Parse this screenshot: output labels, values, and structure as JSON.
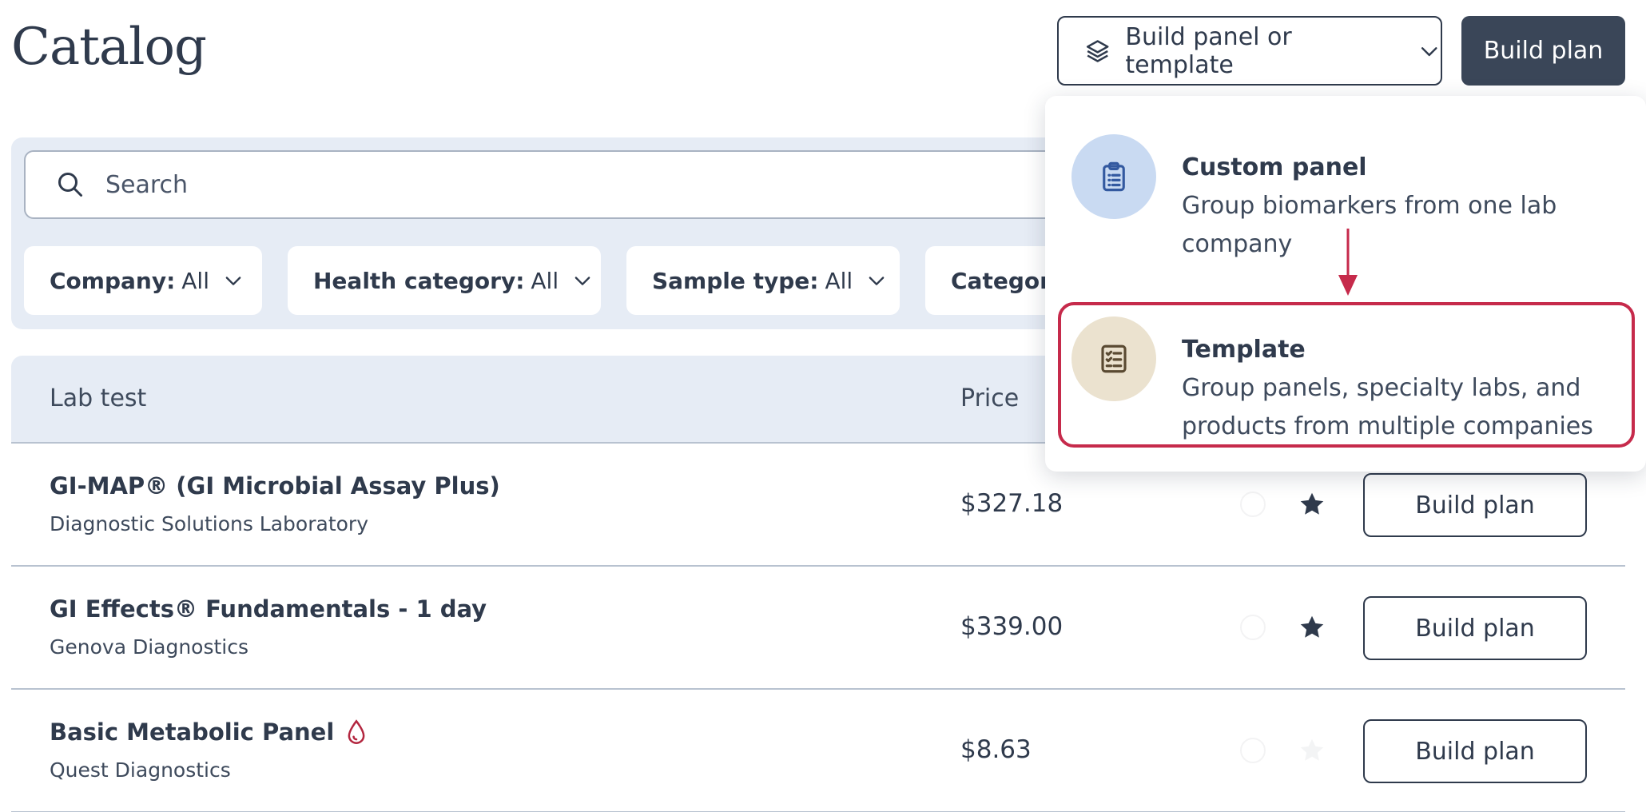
{
  "page": {
    "title": "Catalog"
  },
  "header": {
    "build_dropdown_label": "Build panel or template",
    "build_plan_label": "Build plan"
  },
  "search": {
    "placeholder": "Search"
  },
  "filters": [
    {
      "label": "Company:",
      "value": "All"
    },
    {
      "label": "Health category:",
      "value": "All"
    },
    {
      "label": "Sample type:",
      "value": "All"
    },
    {
      "label": "Category",
      "value": ""
    }
  ],
  "table": {
    "columns": [
      "Lab test",
      "Price"
    ],
    "rows": [
      {
        "name": "GI-MAP® (GI Microbial Assay Plus)",
        "company": "Diagnostic Solutions Laboratory",
        "price": "$327.18",
        "favorited": true,
        "action": "Build plan"
      },
      {
        "name": "GI Effects® Fundamentals - 1 day",
        "company": "Genova Diagnostics",
        "price": "$339.00",
        "favorited": true,
        "action": "Build plan"
      },
      {
        "name": "Basic Metabolic Panel",
        "company": "Quest Diagnostics",
        "price": "$8.63",
        "favorited": false,
        "action": "Build plan"
      }
    ]
  },
  "dropdown": {
    "options": [
      {
        "title": "Custom panel",
        "description": "Group biomarkers from one lab company",
        "icon": "clipboard-list-icon",
        "bubble_color": "#c9daf2"
      },
      {
        "title": "Template",
        "description": "Group panels, specialty labs, and products from multiple companies",
        "icon": "checklist-icon",
        "bubble_color": "#ebe2cf"
      }
    ]
  },
  "colors": {
    "primary": "#3a4658",
    "text": "#2f3a4c",
    "panel_bg": "#e6ecf5",
    "highlight": "#c62a4b"
  }
}
